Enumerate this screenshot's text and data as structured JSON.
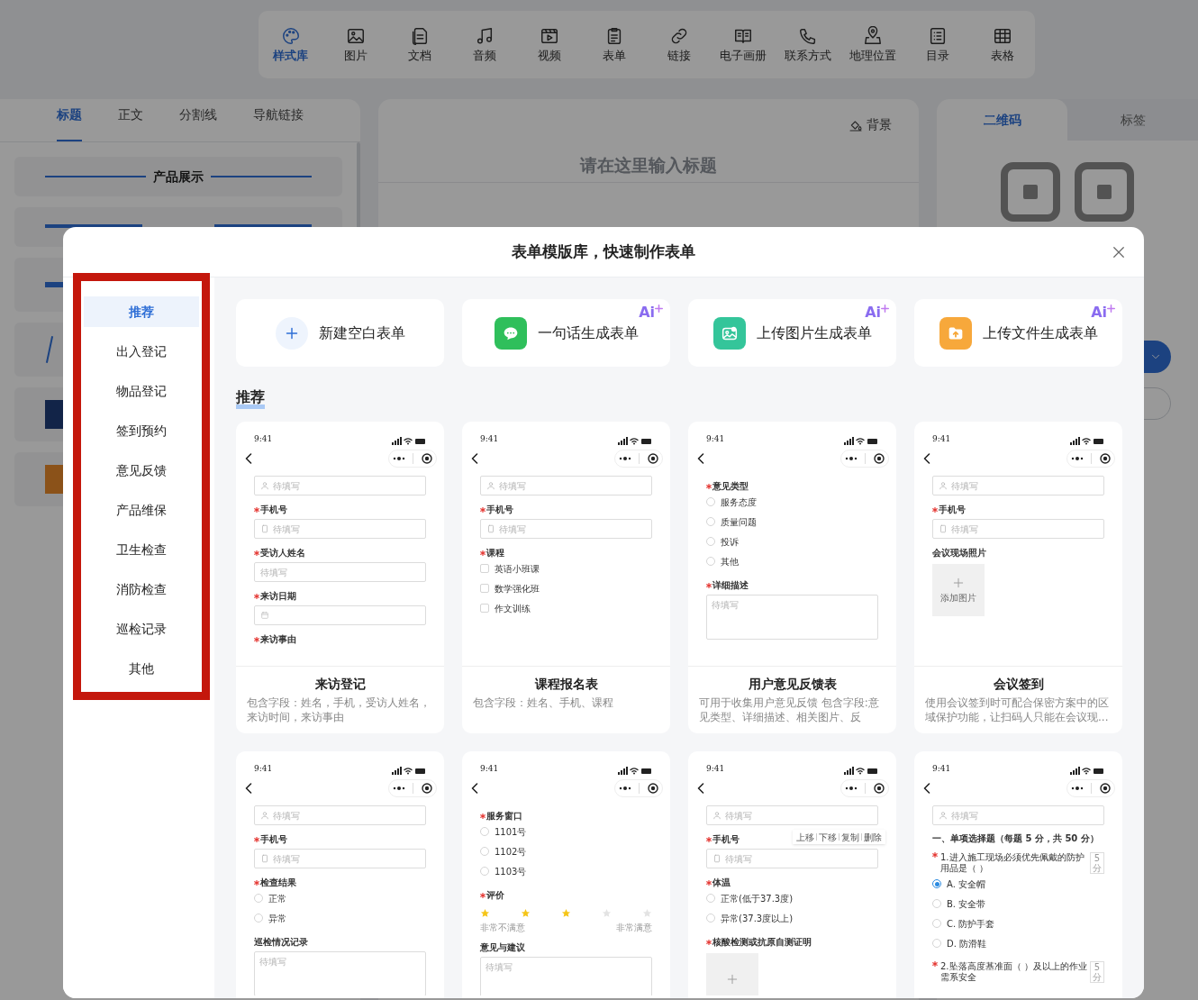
{
  "toolbar": [
    {
      "label": "样式库",
      "selected": true
    },
    {
      "label": "图片",
      "selected": false
    },
    {
      "label": "文档",
      "selected": false
    },
    {
      "label": "音频",
      "selected": false
    },
    {
      "label": "视频",
      "selected": false
    },
    {
      "label": "表单",
      "selected": false
    },
    {
      "label": "链接",
      "selected": false
    },
    {
      "label": "电子画册",
      "selected": false
    },
    {
      "label": "联系方式",
      "selected": false
    },
    {
      "label": "地理位置",
      "selected": false
    },
    {
      "label": "目录",
      "selected": false
    },
    {
      "label": "表格",
      "selected": false
    }
  ],
  "left_panel": {
    "tabs": [
      {
        "label": "标题",
        "selected": true
      },
      {
        "label": "正文",
        "selected": false
      },
      {
        "label": "分割线",
        "selected": false
      },
      {
        "label": "导航链接",
        "selected": false
      }
    ],
    "items": [
      "产品展示"
    ]
  },
  "editor": {
    "background_button": "背景",
    "title_placeholder": "请在这里输入标题"
  },
  "right_panel": {
    "tabs": [
      {
        "label": "二维码",
        "selected": true
      },
      {
        "label": "标签",
        "selected": false
      }
    ]
  },
  "modal": {
    "title": "表单模版库，快速制作表单",
    "categories": [
      {
        "label": "推荐",
        "selected": true
      },
      {
        "label": "出入登记",
        "selected": false
      },
      {
        "label": "物品登记",
        "selected": false
      },
      {
        "label": "签到预约",
        "selected": false
      },
      {
        "label": "意见反馈",
        "selected": false
      },
      {
        "label": "产品维保",
        "selected": false
      },
      {
        "label": "卫生检查",
        "selected": false
      },
      {
        "label": "消防检查",
        "selected": false
      },
      {
        "label": "巡检记录",
        "selected": false
      },
      {
        "label": "其他",
        "selected": false
      }
    ],
    "actions": [
      {
        "label": "新建空白表单"
      },
      {
        "label": "一句话生成表单",
        "badge": "Ai"
      },
      {
        "label": "上传图片生成表单",
        "badge": "Ai"
      },
      {
        "label": "上传文件生成表单",
        "badge": "Ai"
      }
    ],
    "section_title": "推荐",
    "templates": [
      {
        "title": "来访登记",
        "description": "包含字段：姓名，手机，受访人姓名，来访时间，来访事由",
        "preview": {
          "time": "9:41",
          "items": [
            {
              "kind": "person-input",
              "placeholder": "待填写"
            },
            {
              "kind": "label",
              "text": "手机号",
              "required": true
            },
            {
              "kind": "phone-input",
              "placeholder": "待填写"
            },
            {
              "kind": "label",
              "text": "受访人姓名",
              "required": true
            },
            {
              "kind": "input",
              "placeholder": "待填写"
            },
            {
              "kind": "label",
              "text": "来访日期",
              "required": true
            },
            {
              "kind": "date-input"
            },
            {
              "kind": "label",
              "text": "来访事由",
              "required": true
            }
          ]
        }
      },
      {
        "title": "课程报名表",
        "description": "包含字段：姓名、手机、课程",
        "preview": {
          "time": "9:41",
          "items": [
            {
              "kind": "person-input",
              "placeholder": "待填写"
            },
            {
              "kind": "label",
              "text": "手机号",
              "required": true
            },
            {
              "kind": "phone-input",
              "placeholder": "待填写"
            },
            {
              "kind": "label",
              "text": "课程",
              "required": true
            },
            {
              "kind": "checkbox",
              "text": "英语小班课",
              "checked": false
            },
            {
              "kind": "checkbox",
              "text": "数学强化班",
              "checked": false
            },
            {
              "kind": "checkbox",
              "text": "作文训练",
              "checked": false
            }
          ]
        }
      },
      {
        "title": "用户意见反馈表",
        "description": "可用于收集用户意见反馈 包含字段:意见类型、详细描述、相关图片、反",
        "preview": {
          "time": "9:41",
          "items": [
            {
              "kind": "label",
              "text": "意见类型",
              "required": true
            },
            {
              "kind": "radio",
              "text": "服务态度",
              "selected": false
            },
            {
              "kind": "radio",
              "text": "质量问题",
              "selected": false
            },
            {
              "kind": "radio",
              "text": "投诉",
              "selected": false
            },
            {
              "kind": "radio",
              "text": "其他",
              "selected": false
            },
            {
              "kind": "label",
              "text": "详细描述",
              "required": true
            },
            {
              "kind": "textarea",
              "placeholder": "待填写"
            }
          ]
        }
      },
      {
        "title": "会议签到",
        "description": "使用会议签到时可配合保密方案中的区域保护功能，让扫码人只能在会议现...",
        "preview": {
          "time": "9:41",
          "items": [
            {
              "kind": "person-input",
              "placeholder": "待填写"
            },
            {
              "kind": "label",
              "text": "手机号",
              "required": true
            },
            {
              "kind": "phone-input",
              "placeholder": "待填写"
            },
            {
              "kind": "label",
              "text": "会议现场照片",
              "required": false
            },
            {
              "kind": "upload",
              "text": "添加图片"
            }
          ]
        }
      },
      {
        "preview": {
          "time": "9:41",
          "items": [
            {
              "kind": "person-input",
              "placeholder": "待填写"
            },
            {
              "kind": "label",
              "text": "手机号",
              "required": true
            },
            {
              "kind": "phone-input",
              "placeholder": "待填写"
            },
            {
              "kind": "label",
              "text": "检查结果",
              "required": true
            },
            {
              "kind": "radio",
              "text": "正常",
              "selected": false
            },
            {
              "kind": "radio",
              "text": "异常",
              "selected": false
            },
            {
              "kind": "label",
              "text": "巡检情况记录",
              "required": false
            },
            {
              "kind": "textarea",
              "placeholder": "待填写"
            }
          ]
        }
      },
      {
        "preview": {
          "time": "9:41",
          "items": [
            {
              "kind": "label",
              "text": "服务窗口",
              "required": true
            },
            {
              "kind": "radio",
              "text": "1101号",
              "selected": false
            },
            {
              "kind": "radio",
              "text": "1102号",
              "selected": false
            },
            {
              "kind": "radio",
              "text": "1103号",
              "selected": false
            },
            {
              "kind": "label",
              "text": "评价",
              "required": true
            },
            {
              "kind": "rating",
              "stars": 3
            },
            {
              "kind": "scale",
              "low": "非常不满意",
              "high": "非常满意"
            },
            {
              "kind": "label",
              "text": "意见与建议",
              "required": false
            },
            {
              "kind": "textarea",
              "placeholder": "待填写"
            }
          ]
        }
      },
      {
        "preview": {
          "time": "9:41",
          "items": [
            {
              "kind": "person-input",
              "placeholder": "待填写"
            },
            {
              "kind": "label",
              "text": "手机号",
              "required": true,
              "actions": [
                "上移",
                "下移",
                "复制",
                "删除"
              ]
            },
            {
              "kind": "phone-input",
              "placeholder": "待填写"
            },
            {
              "kind": "label",
              "text": "体温",
              "required": true
            },
            {
              "kind": "radio",
              "text": "正常(低于37.3度)",
              "selected": false
            },
            {
              "kind": "radio",
              "text": "异常(37.3度以上)",
              "selected": false
            },
            {
              "kind": "label",
              "text": "核酸检测或抗原自测证明",
              "required": true
            },
            {
              "kind": "upload"
            }
          ]
        }
      },
      {
        "preview": {
          "time": "9:41",
          "items": [
            {
              "kind": "person-input",
              "placeholder": "待填写"
            },
            {
              "kind": "section",
              "text": "一、单项选择题（每题 5 分，共 50 分）"
            },
            {
              "kind": "question",
              "text": "1.进入施工现场必须优先佩戴的防护用品是（ ）",
              "required": true,
              "score": "5分"
            },
            {
              "kind": "radio",
              "text": "A. 安全帽",
              "selected": true
            },
            {
              "kind": "radio",
              "text": "B. 安全带",
              "selected": false
            },
            {
              "kind": "radio",
              "text": "C. 防护手套",
              "selected": false
            },
            {
              "kind": "radio",
              "text": "D. 防滑鞋",
              "selected": false
            },
            {
              "kind": "question",
              "text": "2.坠落高度基准面（ ）及以上的作业需系安全",
              "required": true,
              "score": "5分"
            }
          ]
        }
      }
    ]
  }
}
